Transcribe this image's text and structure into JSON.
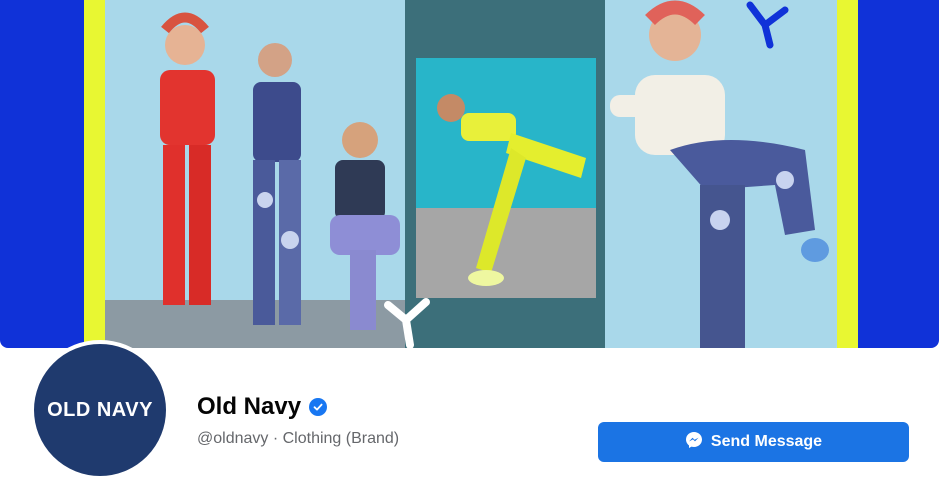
{
  "brand": {
    "name": "Old Navy",
    "handle": "@oldnavy",
    "separator": " · ",
    "category": "Clothing (Brand)",
    "logo_text": "OLD NAVY"
  },
  "actions": {
    "send_message_label": "Send Message"
  },
  "icons": {
    "verified": "verified-badge-icon",
    "messenger": "messenger-icon"
  },
  "colors": {
    "cover_blue": "#1032d8",
    "accent_yellow": "#e8f732",
    "panel_sky": "#a9d8ea",
    "panel_teal": "#3c6f7a",
    "logo_bg": "#1f3a6e",
    "fb_blue": "#1b74e4",
    "verified_blue": "#1877f2"
  }
}
